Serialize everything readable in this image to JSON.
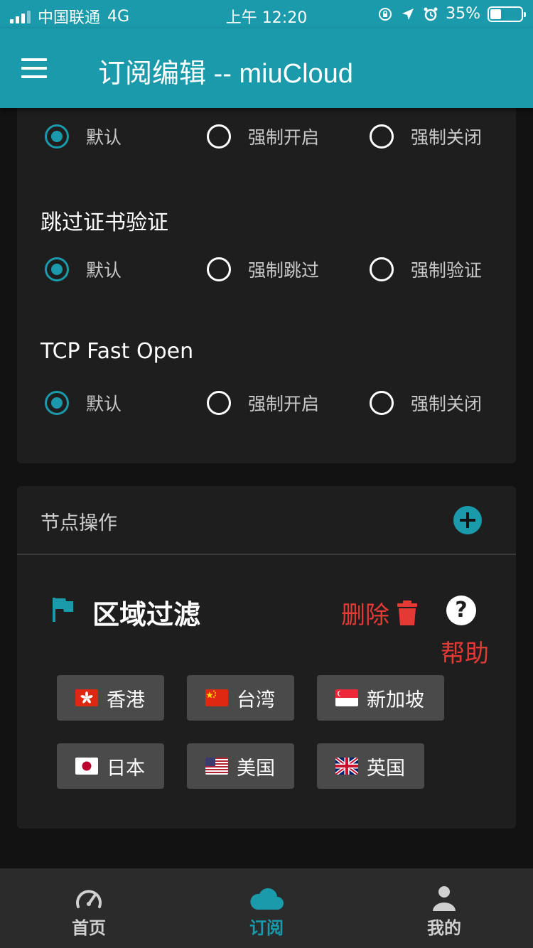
{
  "status_bar": {
    "carrier": "中国联通",
    "network": "4G",
    "time": "上午 12:20",
    "battery": "35%",
    "battery_level": 0.35
  },
  "app_bar": {
    "title": "订阅编辑 -- miuCloud",
    "menu_icon": "hamburger-menu-icon"
  },
  "settings": {
    "groups": [
      {
        "title": "",
        "options": [
          "默认",
          "强制开启",
          "强制关闭"
        ],
        "selected": 0
      },
      {
        "title": "跳过证书验证",
        "options": [
          "默认",
          "强制跳过",
          "强制验证"
        ],
        "selected": 0
      },
      {
        "title": "TCP Fast Open",
        "options": [
          "默认",
          "强制开启",
          "强制关闭"
        ],
        "selected": 0
      }
    ]
  },
  "node_ops": {
    "header": "节点操作",
    "add_icon": "plus-circle-icon",
    "filter": {
      "title": "区域过滤",
      "delete_label": "删除",
      "help_label": "帮助",
      "help_glyph": "?",
      "regions": [
        {
          "label": "香港",
          "flag": "flag-hk-icon"
        },
        {
          "label": "台湾",
          "flag": "flag-cn-icon"
        },
        {
          "label": "新加坡",
          "flag": "flag-sg-icon"
        },
        {
          "label": "日本",
          "flag": "flag-jp-icon"
        },
        {
          "label": "美国",
          "flag": "flag-us-icon"
        },
        {
          "label": "英国",
          "flag": "flag-gb-icon"
        }
      ]
    }
  },
  "bottom_nav": {
    "items": [
      {
        "label": "首页",
        "icon": "speedometer-icon"
      },
      {
        "label": "订阅",
        "icon": "cloud-icon"
      },
      {
        "label": "我的",
        "icon": "person-icon"
      }
    ],
    "active_index": 1
  },
  "colors": {
    "accent": "#1a9aab",
    "danger": "#e53935",
    "background": "#121212",
    "card": "#1e1e1e",
    "chip": "#4a4a4a",
    "nav": "#2b2b2b"
  }
}
